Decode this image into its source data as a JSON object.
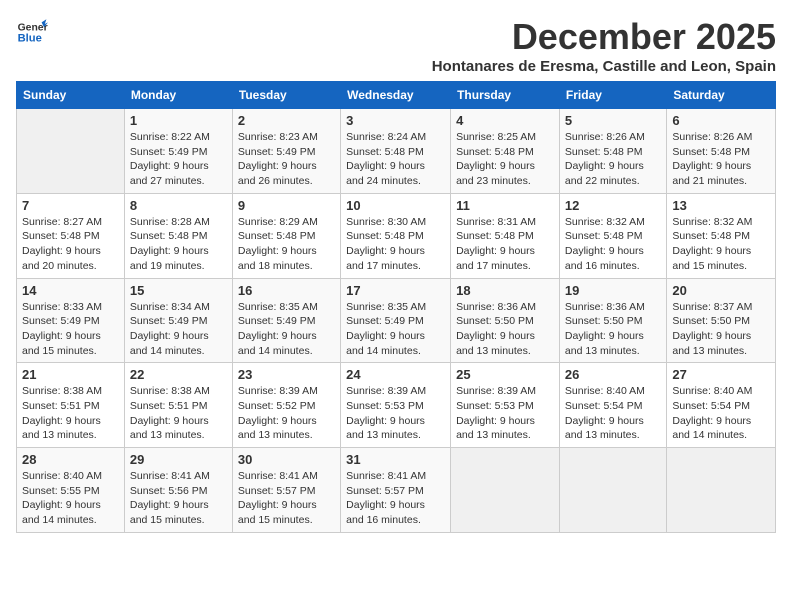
{
  "header": {
    "logo_general": "General",
    "logo_blue": "Blue",
    "month_title": "December 2025",
    "location": "Hontanares de Eresma, Castille and Leon, Spain"
  },
  "weekdays": [
    "Sunday",
    "Monday",
    "Tuesday",
    "Wednesday",
    "Thursday",
    "Friday",
    "Saturday"
  ],
  "weeks": [
    [
      {
        "day": "",
        "sunrise": "",
        "sunset": "",
        "daylight": ""
      },
      {
        "day": "1",
        "sunrise": "Sunrise: 8:22 AM",
        "sunset": "Sunset: 5:49 PM",
        "daylight": "Daylight: 9 hours and 27 minutes."
      },
      {
        "day": "2",
        "sunrise": "Sunrise: 8:23 AM",
        "sunset": "Sunset: 5:49 PM",
        "daylight": "Daylight: 9 hours and 26 minutes."
      },
      {
        "day": "3",
        "sunrise": "Sunrise: 8:24 AM",
        "sunset": "Sunset: 5:48 PM",
        "daylight": "Daylight: 9 hours and 24 minutes."
      },
      {
        "day": "4",
        "sunrise": "Sunrise: 8:25 AM",
        "sunset": "Sunset: 5:48 PM",
        "daylight": "Daylight: 9 hours and 23 minutes."
      },
      {
        "day": "5",
        "sunrise": "Sunrise: 8:26 AM",
        "sunset": "Sunset: 5:48 PM",
        "daylight": "Daylight: 9 hours and 22 minutes."
      },
      {
        "day": "6",
        "sunrise": "Sunrise: 8:26 AM",
        "sunset": "Sunset: 5:48 PM",
        "daylight": "Daylight: 9 hours and 21 minutes."
      }
    ],
    [
      {
        "day": "7",
        "sunrise": "Sunrise: 8:27 AM",
        "sunset": "Sunset: 5:48 PM",
        "daylight": "Daylight: 9 hours and 20 minutes."
      },
      {
        "day": "8",
        "sunrise": "Sunrise: 8:28 AM",
        "sunset": "Sunset: 5:48 PM",
        "daylight": "Daylight: 9 hours and 19 minutes."
      },
      {
        "day": "9",
        "sunrise": "Sunrise: 8:29 AM",
        "sunset": "Sunset: 5:48 PM",
        "daylight": "Daylight: 9 hours and 18 minutes."
      },
      {
        "day": "10",
        "sunrise": "Sunrise: 8:30 AM",
        "sunset": "Sunset: 5:48 PM",
        "daylight": "Daylight: 9 hours and 17 minutes."
      },
      {
        "day": "11",
        "sunrise": "Sunrise: 8:31 AM",
        "sunset": "Sunset: 5:48 PM",
        "daylight": "Daylight: 9 hours and 17 minutes."
      },
      {
        "day": "12",
        "sunrise": "Sunrise: 8:32 AM",
        "sunset": "Sunset: 5:48 PM",
        "daylight": "Daylight: 9 hours and 16 minutes."
      },
      {
        "day": "13",
        "sunrise": "Sunrise: 8:32 AM",
        "sunset": "Sunset: 5:48 PM",
        "daylight": "Daylight: 9 hours and 15 minutes."
      }
    ],
    [
      {
        "day": "14",
        "sunrise": "Sunrise: 8:33 AM",
        "sunset": "Sunset: 5:49 PM",
        "daylight": "Daylight: 9 hours and 15 minutes."
      },
      {
        "day": "15",
        "sunrise": "Sunrise: 8:34 AM",
        "sunset": "Sunset: 5:49 PM",
        "daylight": "Daylight: 9 hours and 14 minutes."
      },
      {
        "day": "16",
        "sunrise": "Sunrise: 8:35 AM",
        "sunset": "Sunset: 5:49 PM",
        "daylight": "Daylight: 9 hours and 14 minutes."
      },
      {
        "day": "17",
        "sunrise": "Sunrise: 8:35 AM",
        "sunset": "Sunset: 5:49 PM",
        "daylight": "Daylight: 9 hours and 14 minutes."
      },
      {
        "day": "18",
        "sunrise": "Sunrise: 8:36 AM",
        "sunset": "Sunset: 5:50 PM",
        "daylight": "Daylight: 9 hours and 13 minutes."
      },
      {
        "day": "19",
        "sunrise": "Sunrise: 8:36 AM",
        "sunset": "Sunset: 5:50 PM",
        "daylight": "Daylight: 9 hours and 13 minutes."
      },
      {
        "day": "20",
        "sunrise": "Sunrise: 8:37 AM",
        "sunset": "Sunset: 5:50 PM",
        "daylight": "Daylight: 9 hours and 13 minutes."
      }
    ],
    [
      {
        "day": "21",
        "sunrise": "Sunrise: 8:38 AM",
        "sunset": "Sunset: 5:51 PM",
        "daylight": "Daylight: 9 hours and 13 minutes."
      },
      {
        "day": "22",
        "sunrise": "Sunrise: 8:38 AM",
        "sunset": "Sunset: 5:51 PM",
        "daylight": "Daylight: 9 hours and 13 minutes."
      },
      {
        "day": "23",
        "sunrise": "Sunrise: 8:39 AM",
        "sunset": "Sunset: 5:52 PM",
        "daylight": "Daylight: 9 hours and 13 minutes."
      },
      {
        "day": "24",
        "sunrise": "Sunrise: 8:39 AM",
        "sunset": "Sunset: 5:53 PM",
        "daylight": "Daylight: 9 hours and 13 minutes."
      },
      {
        "day": "25",
        "sunrise": "Sunrise: 8:39 AM",
        "sunset": "Sunset: 5:53 PM",
        "daylight": "Daylight: 9 hours and 13 minutes."
      },
      {
        "day": "26",
        "sunrise": "Sunrise: 8:40 AM",
        "sunset": "Sunset: 5:54 PM",
        "daylight": "Daylight: 9 hours and 13 minutes."
      },
      {
        "day": "27",
        "sunrise": "Sunrise: 8:40 AM",
        "sunset": "Sunset: 5:54 PM",
        "daylight": "Daylight: 9 hours and 14 minutes."
      }
    ],
    [
      {
        "day": "28",
        "sunrise": "Sunrise: 8:40 AM",
        "sunset": "Sunset: 5:55 PM",
        "daylight": "Daylight: 9 hours and 14 minutes."
      },
      {
        "day": "29",
        "sunrise": "Sunrise: 8:41 AM",
        "sunset": "Sunset: 5:56 PM",
        "daylight": "Daylight: 9 hours and 15 minutes."
      },
      {
        "day": "30",
        "sunrise": "Sunrise: 8:41 AM",
        "sunset": "Sunset: 5:57 PM",
        "daylight": "Daylight: 9 hours and 15 minutes."
      },
      {
        "day": "31",
        "sunrise": "Sunrise: 8:41 AM",
        "sunset": "Sunset: 5:57 PM",
        "daylight": "Daylight: 9 hours and 16 minutes."
      },
      {
        "day": "",
        "sunrise": "",
        "sunset": "",
        "daylight": ""
      },
      {
        "day": "",
        "sunrise": "",
        "sunset": "",
        "daylight": ""
      },
      {
        "day": "",
        "sunrise": "",
        "sunset": "",
        "daylight": ""
      }
    ]
  ]
}
